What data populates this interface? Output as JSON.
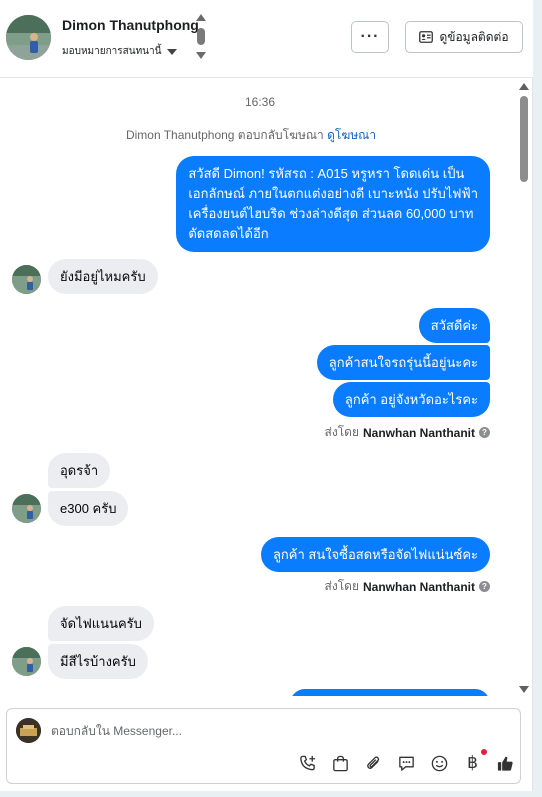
{
  "header": {
    "contact_name": "Dimon Thanutphong",
    "assign_label": "มอบหมายการสนทนานี้",
    "more_label": "···",
    "view_contact_label": "ดูข้อมูลติดต่อ"
  },
  "chat": {
    "timestamp": "16:36",
    "ad_reply": {
      "prefix": "Dimon Thanutphong ตอบกลับโฆษณา",
      "link": "ดูโฆษณา"
    },
    "messages": [
      {
        "from": "page",
        "lines": [
          "สวัสดี Dimon! รหัสรถ : A015 หรูหรา โดดเด่น เป็น",
          "เอกลักษณ์ ภายในตกแต่งอย่างดี เบาะหนัง ปรับไฟฟ้า",
          "เครื่องยนต์ไฮบริด ช่วงล่างดีสุด ส่วนลด 60,000 บาท",
          "ตัดสดลดได้อีก"
        ]
      },
      {
        "from": "customer",
        "text": "ยังมีอยู่ไหมครับ"
      },
      {
        "from": "page",
        "text": "สวัสดีค่ะ"
      },
      {
        "from": "page",
        "text": "ลูกค้าสนใจรถรุ่นนี้อยู่นะคะ"
      },
      {
        "from": "page",
        "text": "ลูกค้า อยู่จังหวัดอะไรคะ"
      },
      {
        "from": "customer",
        "text": "อุดรจ้า"
      },
      {
        "from": "customer",
        "text": "e300 ครับ"
      },
      {
        "from": "page",
        "text": "ลูกค้า สนใจซื้อสดหรือจัดไฟแน่นซ์คะ"
      },
      {
        "from": "customer",
        "text": "จัดไฟแนนครับ"
      },
      {
        "from": "customer",
        "text": "มีสีไรบ้างครับ"
      }
    ],
    "sent_by_1": {
      "prefix": "ส่งโดย",
      "name": "Nanwhan Nanthanit",
      "icon": "?"
    },
    "sent_by_2": {
      "prefix": "ส่งโดย",
      "name": "Nanwhan Nanthanit",
      "icon": "?"
    }
  },
  "composer": {
    "placeholder": "ตอบกลับใน Messenger...",
    "tools": [
      "call-plus-icon",
      "shopping-bag-icon",
      "paperclip-icon",
      "saved-replies-icon",
      "emoji-icon",
      "baht-icon",
      "like-icon"
    ],
    "baht_symbol": "฿"
  },
  "colors": {
    "outgoing_bubble": "#0a7cff",
    "incoming_bubble": "#ebedf0",
    "link": "#1263c4",
    "notification_dot": "#e41e3f"
  }
}
